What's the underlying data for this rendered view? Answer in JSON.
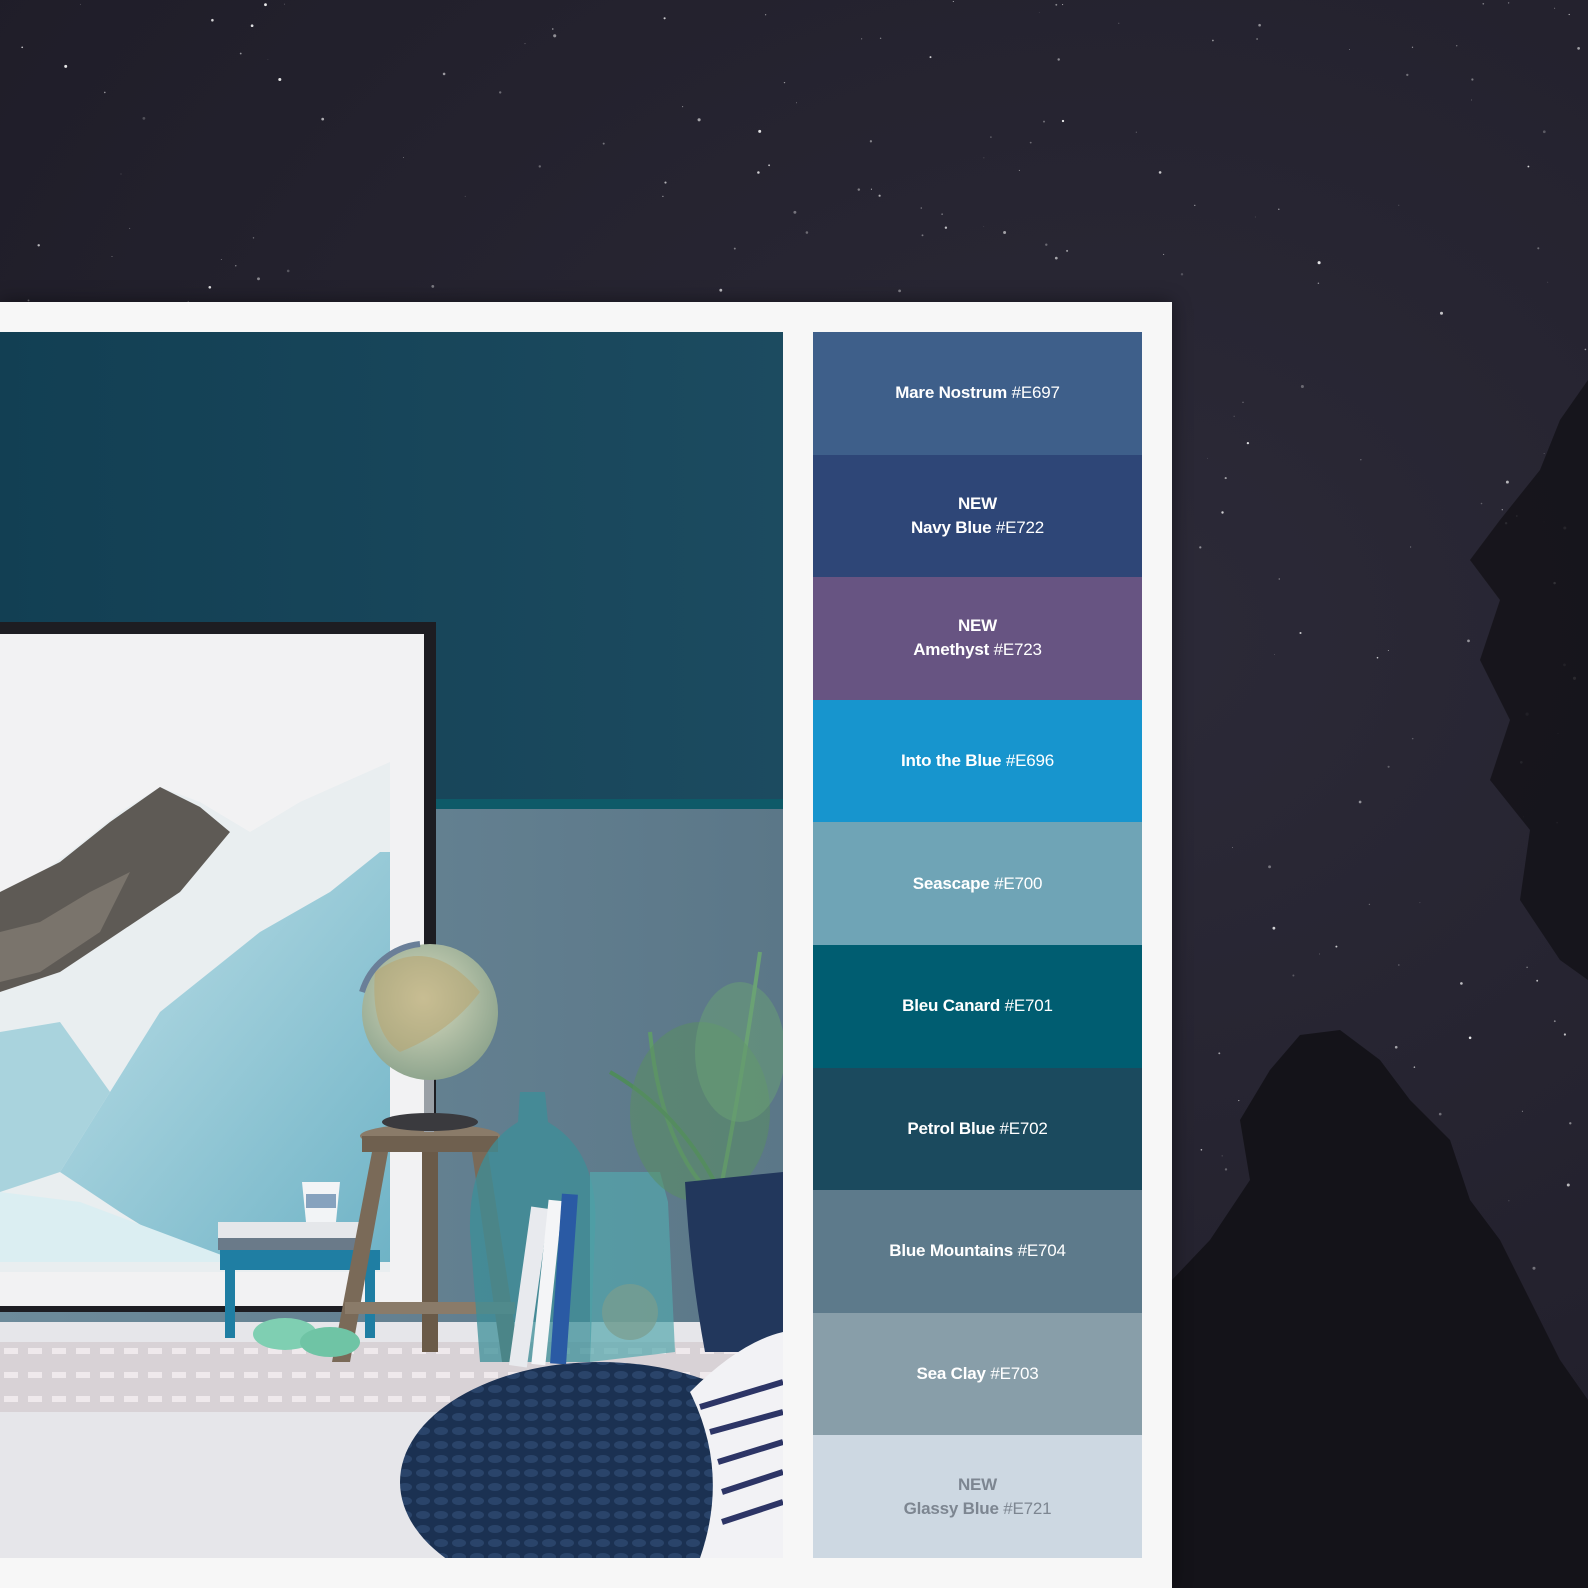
{
  "palette": {
    "swatches": [
      {
        "tag": "",
        "name": "Mare Nostrum",
        "code": "#E697",
        "color": "#3e5f8a",
        "text_color": "#ffffff"
      },
      {
        "tag": "NEW",
        "name": "Navy Blue",
        "code": "#E722",
        "color": "#2e4677",
        "text_color": "#ffffff"
      },
      {
        "tag": "NEW",
        "name": "Amethyst",
        "code": "#E723",
        "color": "#675482",
        "text_color": "#ffffff"
      },
      {
        "tag": "",
        "name": "Into the Blue",
        "code": "#E696",
        "color": "#1795ce",
        "text_color": "#ffffff"
      },
      {
        "tag": "",
        "name": "Seascape",
        "code": "#E700",
        "color": "#6fa4b6",
        "text_color": "#ffffff"
      },
      {
        "tag": "",
        "name": "Bleu Canard",
        "code": "#E701",
        "color": "#005d71",
        "text_color": "#ffffff"
      },
      {
        "tag": "",
        "name": "Petrol Blue",
        "code": "#E702",
        "color": "#1b4a5e",
        "text_color": "#ffffff"
      },
      {
        "tag": "",
        "name": "Blue Mountains",
        "code": "#E704",
        "color": "#5d7a8b",
        "text_color": "#ffffff"
      },
      {
        "tag": "",
        "name": "Sea Clay",
        "code": "#E703",
        "color": "#889ea9",
        "text_color": "#ffffff"
      },
      {
        "tag": "NEW",
        "name": "Glassy Blue",
        "code": "#E721",
        "color": "#cdd8e2",
        "text_color": "#7d8691"
      }
    ]
  },
  "colors": {
    "night_sky": "#23212d",
    "card_background": "#f7f7f7",
    "wall_upper": "#1b4a5e",
    "wall_lower": "#5f7d8e"
  }
}
